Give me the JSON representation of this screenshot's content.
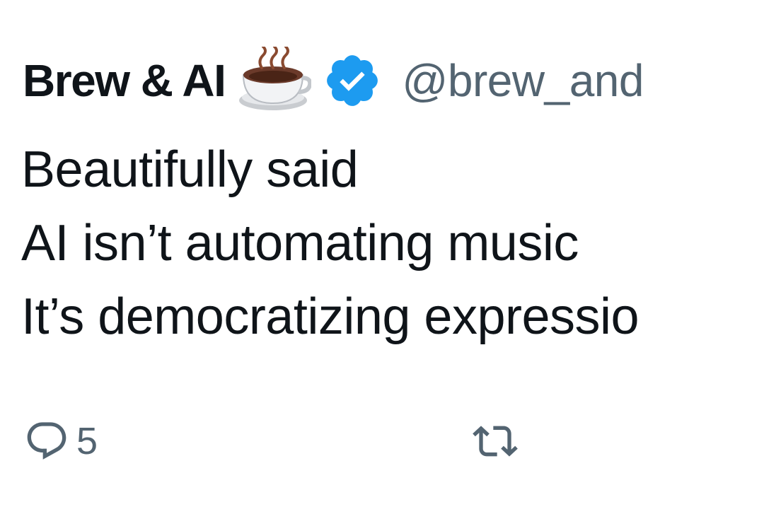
{
  "tweet": {
    "display_name": "Brew & AI",
    "name_emoji": "coffee-cup-icon",
    "verified_badge": "verified-badge-icon",
    "handle": "@brew_and",
    "body_lines": [
      "Beautifully said",
      "AI isn’t automating music",
      "It’s democratizing expressio"
    ]
  },
  "actions": {
    "reply": {
      "icon": "reply-icon",
      "count": "5"
    },
    "retweet": {
      "icon": "retweet-icon",
      "count": ""
    }
  },
  "colors": {
    "text_primary": "#0f1419",
    "text_secondary": "#536471",
    "verified_blue": "#1d9bf0",
    "background": "#ffffff"
  }
}
